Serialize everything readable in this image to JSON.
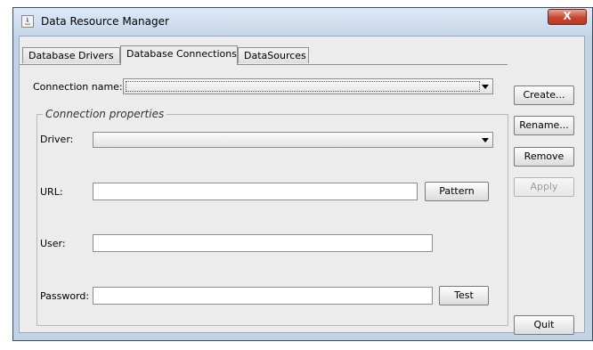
{
  "window": {
    "title": "Data Resource Manager",
    "close_label": "X"
  },
  "tabs": [
    {
      "label": "Database Drivers"
    },
    {
      "label": "Database Connections"
    },
    {
      "label": "DataSources"
    }
  ],
  "connection": {
    "label": "Connection name:",
    "value": ""
  },
  "properties": {
    "group_label": "Connection properties",
    "driver_label": "Driver:",
    "driver_value": "",
    "url_label": "URL:",
    "url_value": "",
    "pattern_label": "Pattern",
    "user_label": "User:",
    "user_value": "",
    "password_label": "Password:",
    "password_value": "",
    "test_label": "Test"
  },
  "side_buttons": {
    "create": "Create...",
    "rename": "Rename...",
    "remove": "Remove",
    "apply": "Apply",
    "quit": "Quit"
  }
}
